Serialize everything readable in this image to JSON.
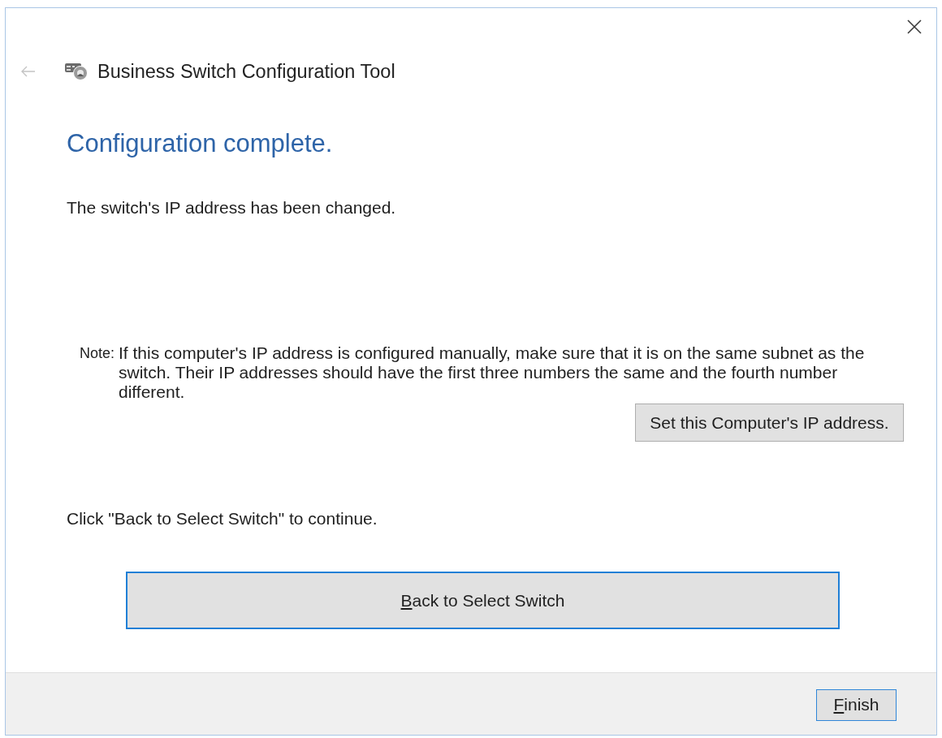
{
  "header": {
    "back_button": {
      "disabled": true
    },
    "app_title": "Business Switch Configuration Tool"
  },
  "page": {
    "heading": "Configuration complete.",
    "message": "The switch's IP address has been changed.",
    "note": {
      "label": "Note:",
      "text": "If this computer's IP address is configured manually, make sure that it is on the same subnet as the switch. Their IP addresses should have the first three numbers the same and the fourth number different."
    },
    "note_button": {
      "label": "Set this Computer's IP address.",
      "focused": false,
      "access_key_underlined": false
    },
    "instruction": "Click \"Back to Select Switch\" to continue.",
    "main_button": {
      "label": "Back to Select Switch",
      "focused": true,
      "access_key_underlined": true
    }
  },
  "footer": {
    "buttons": [
      {
        "label": "Finish",
        "focused": false,
        "default": true,
        "access_key_underlined": true
      }
    ]
  }
}
